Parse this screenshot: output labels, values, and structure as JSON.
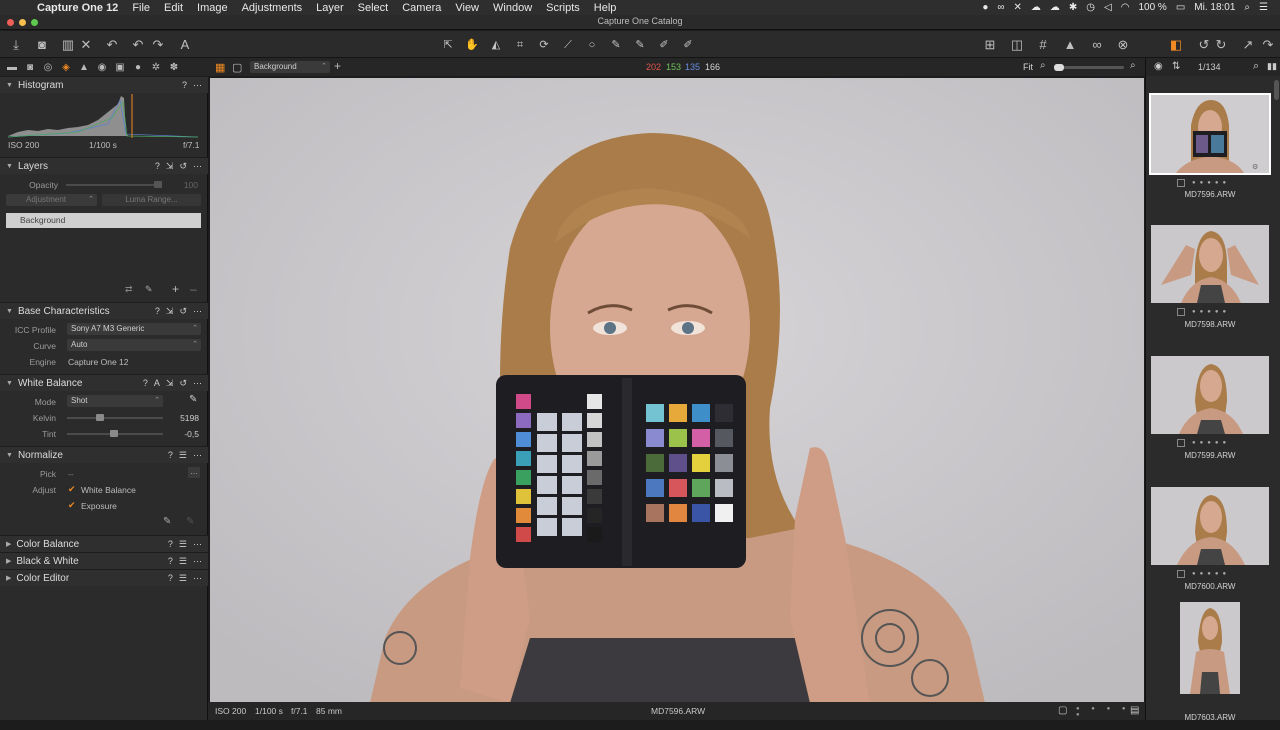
{
  "menubar": {
    "app_name": "Capture One 12",
    "items": [
      "File",
      "Edit",
      "Image",
      "Adjustments",
      "Layer",
      "Select",
      "Camera",
      "View",
      "Window",
      "Scripts",
      "Help"
    ],
    "battery": "100 %",
    "clock": "Mi. 18:01"
  },
  "window": {
    "title": "Capture One Catalog"
  },
  "viewer_header": {
    "layer_select": "Background",
    "rgb": {
      "r": "202",
      "g": "153",
      "b": "135",
      "l": "166"
    },
    "zoom_label": "Fit"
  },
  "histogram": {
    "title": "Histogram",
    "iso": "ISO 200",
    "shutter": "1/100 s",
    "aperture": "f/7.1"
  },
  "layers": {
    "title": "Layers",
    "opacity_label": "Opacity",
    "opacity_value": "100",
    "adjustment_button": "Adjustment",
    "luma_button": "Luma Range...",
    "layer_name": "Background"
  },
  "base": {
    "title": "Base Characteristics",
    "icc_label": "ICC Profile",
    "icc_value": "Sony A7 M3 Generic",
    "curve_label": "Curve",
    "curve_value": "Auto",
    "engine_label": "Engine",
    "engine_value": "Capture One 12"
  },
  "white_balance": {
    "title": "White Balance",
    "mode_label": "Mode",
    "mode_value": "Shot",
    "kelvin_label": "Kelvin",
    "kelvin_value": "5198",
    "tint_label": "Tint",
    "tint_value": "-0,5"
  },
  "normalize": {
    "title": "Normalize",
    "pick_label": "Pick",
    "pick_value": "--",
    "adjust_label": "Adjust",
    "wb_option": "White Balance",
    "exposure_option": "Exposure"
  },
  "collapsed_tools": [
    "Color Balance",
    "Black & White",
    "Color Editor"
  ],
  "status": {
    "iso": "ISO 200",
    "shutter": "1/100 s",
    "aperture": "f/7.1",
    "focal": "85 mm",
    "filename": "MD7596.ARW"
  },
  "browser": {
    "counter": "1/134",
    "thumbnails": [
      "MD7596.ARW",
      "MD7598.ARW",
      "MD7599.ARW",
      "MD7600.ARW",
      "MD7603.ARW"
    ]
  },
  "colors": {
    "accent": "#f08a24",
    "panel": "#2b2b2b",
    "background": "#cfcdd0"
  }
}
